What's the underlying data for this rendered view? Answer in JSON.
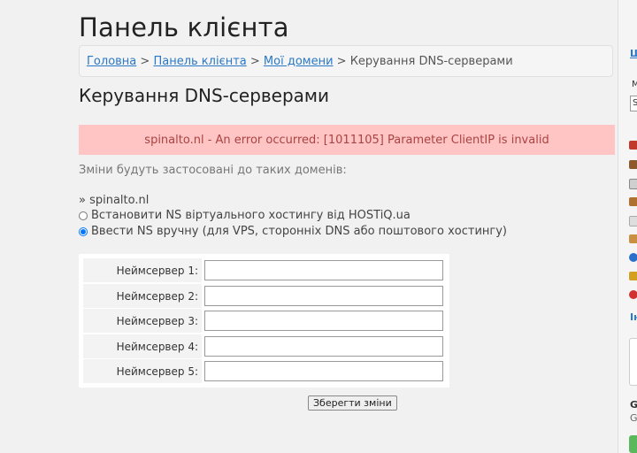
{
  "page_title": "Панель клієнта",
  "breadcrumb": {
    "items": [
      {
        "label": "Головна",
        "link": true
      },
      {
        "label": "Панель клієнта",
        "link": true
      },
      {
        "label": "Мої домени",
        "link": true
      },
      {
        "label": "Керування DNS-серверами",
        "link": false
      }
    ],
    "separator": ">"
  },
  "section_title": "Керування DNS-серверами",
  "alert": {
    "text": "spinalto.nl - An error occurred: [1011105] Parameter ClientIP is invalid",
    "color": "#ffc4c4"
  },
  "intro": "Зміни будуть застосовані до таких доменів:",
  "domain": "» spinalto.nl",
  "options": [
    {
      "label": "Встановити NS віртуального хостингу від HOSTiQ.ua",
      "checked": false
    },
    {
      "label": "Ввести NS вручну (для VPS, сторонніх DNS або поштового хостингу)",
      "checked": true
    }
  ],
  "nameservers": [
    {
      "label": "Неймсервер 1:",
      "value": ""
    },
    {
      "label": "Неймсервер 2:",
      "value": ""
    },
    {
      "label": "Неймсервер 3:",
      "value": ""
    },
    {
      "label": "Неймсервер 4:",
      "value": ""
    },
    {
      "label": "Неймсервер 5:",
      "value": ""
    }
  ],
  "save_label": "Зберегти зміни",
  "sidebar": {
    "top_link": "Щ",
    "label_m": "М",
    "select_char": "S",
    "heading_i": "Ін",
    "heading_g": "G",
    "text_g": "G",
    "icons": [
      "chart-icon",
      "home-icon",
      "monitor-icon",
      "tag-icon",
      "mail-icon",
      "package-icon",
      "globe-icon",
      "database-icon",
      "help-icon"
    ],
    "icon_colors": [
      "#c0392b",
      "#8e5a2b",
      "#888888",
      "#b07030",
      "#aaaaaa",
      "#c89040",
      "#2a6fc9",
      "#d4a020",
      "#d03030"
    ]
  }
}
